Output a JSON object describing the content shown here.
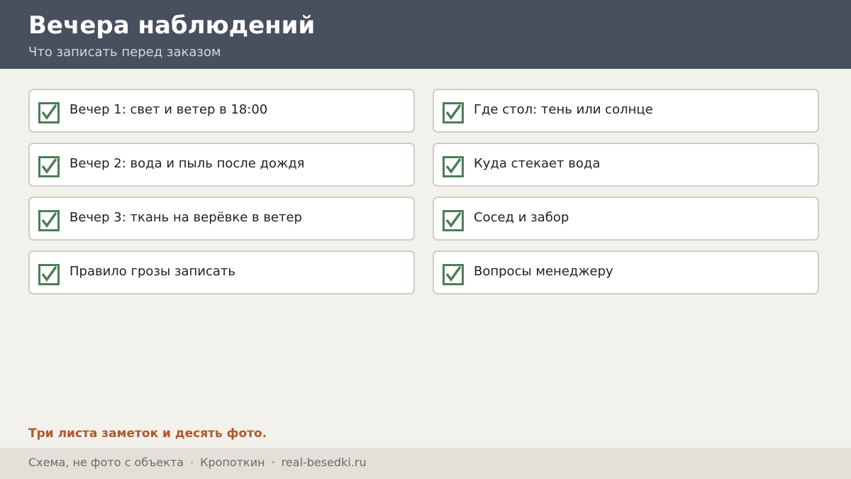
{
  "header": {
    "title": "Вечера наблюдений",
    "subtitle": "Что записать перед заказом"
  },
  "checklist": {
    "left": [
      {
        "label": "Вечер 1: свет и ветер в 18:00",
        "checked": true
      },
      {
        "label": "Вечер 2: вода и пыль после дождя",
        "checked": true
      },
      {
        "label": "Вечер 3: ткань на верёвке в ветер",
        "checked": true
      },
      {
        "label": "Правило грозы записать",
        "checked": true
      }
    ],
    "right": [
      {
        "label": "Где стол: тень или солнце",
        "checked": true
      },
      {
        "label": "Куда стекает вода",
        "checked": true
      },
      {
        "label": "Сосед и забор",
        "checked": true
      },
      {
        "label": "Вопросы менеджеру",
        "checked": true
      }
    ]
  },
  "note": "Три листа заметок и десять фото.",
  "footer": {
    "parts": [
      "Схема, не фото с объекта",
      "Кропоткин",
      "real-besedki.ru"
    ],
    "separator": "·"
  },
  "colors": {
    "header_bg": "#47505d",
    "checkbox": "#4e7d57",
    "note": "#b4572a",
    "page_bg": "#f3f1ec",
    "footer_bg": "#e3e0d9"
  },
  "icons": {
    "checkbox": "checkbox-checked-icon"
  }
}
